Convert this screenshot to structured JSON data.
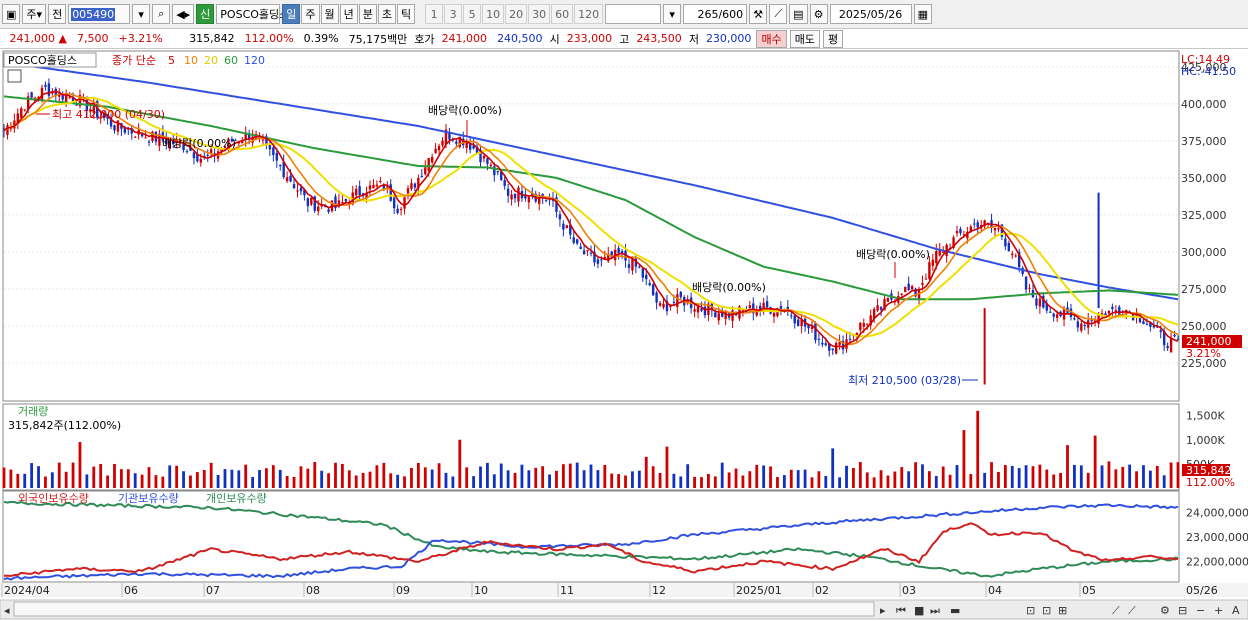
{
  "toolbar": {
    "type_label": "주",
    "prev_label": "전",
    "code": "005490",
    "badge": "신",
    "name": "POSCO홀딩스",
    "periods": [
      "일",
      "주",
      "월",
      "년",
      "분",
      "초",
      "틱"
    ],
    "active_period": "일",
    "intervals": [
      "1",
      "3",
      "5",
      "10",
      "20",
      "30",
      "60",
      "120"
    ],
    "count": "265",
    "count_max": "/600",
    "date": "2025/05/26"
  },
  "infobar": {
    "price": "241,000",
    "arrow": "▲",
    "change": "7,500",
    "change_pct": "+3.21%",
    "volume": "315,842",
    "vol_ratio": "112.00%",
    "turnover": "0.39%",
    "amount": "75,175백만",
    "quote_label": "호가",
    "ask": "241,000",
    "bid": "240,500",
    "open_label": "시",
    "open": "233,000",
    "high_label": "고",
    "high": "243,500",
    "low_label": "저",
    "low": "230,000",
    "buy_label": "매수",
    "sell_label": "매도",
    "avg_label": "평"
  },
  "legend": {
    "name": "POSCO홀딩스",
    "series": "종가 단순",
    "ma": [
      "5",
      "10",
      "20",
      "60",
      "120"
    ]
  },
  "side": {
    "lc": "LC:14.49",
    "hc": "HC:-41.50",
    "last": "241,000",
    "pct": "3.21%",
    "vol_last": "315,842",
    "vol_pct": "112.00%"
  },
  "volume_panel": {
    "title": "거래량",
    "value": "315,842주(112.00%)"
  },
  "holdings_panel": {
    "series": [
      "외국인보유수량",
      "기관보유수량",
      "개인보유수량"
    ]
  },
  "annotations": {
    "high": "최고 412,000 (04/30)",
    "low": "최저 210,500 (03/28)",
    "dividend": "배당락(0.00%)"
  },
  "colors": {
    "up": "#d00000",
    "down": "#1030c0",
    "ma5": "#d00000",
    "ma10": "#f08000",
    "ma20": "#f0e000",
    "ma60": "#2a9a3a",
    "ma120": "#3050e0",
    "foreign": "#d02020",
    "inst": "#3050e0",
    "indiv": "#2e8b57",
    "volume": "#d00000"
  },
  "chart_data": {
    "type": "candlestick",
    "price_axis": {
      "ticks": [
        225000,
        250000,
        275000,
        300000,
        325000,
        350000,
        375000,
        400000,
        425000
      ],
      "range": [
        200000,
        435000
      ]
    },
    "volume_axis": {
      "ticks": [
        "1,500K",
        "1,000K",
        "500K"
      ],
      "range": [
        0,
        1700
      ]
    },
    "holdings_axis": {
      "ticks": [
        "24,000,000",
        "23,000,000",
        "22,000,000"
      ],
      "range": [
        21200000,
        24800000
      ]
    },
    "x_labels": [
      "2024/04",
      "06",
      "07",
      "08",
      "09",
      "10",
      "11",
      "12",
      "2025/01",
      "02",
      "03",
      "04",
      "05",
      "05/26"
    ],
    "close_keypoints": [
      [
        0,
        382000
      ],
      [
        6,
        400000
      ],
      [
        12,
        410000
      ],
      [
        22,
        402000
      ],
      [
        32,
        385000
      ],
      [
        42,
        378000
      ],
      [
        52,
        372000
      ],
      [
        58,
        362000
      ],
      [
        66,
        375000
      ],
      [
        72,
        380000
      ],
      [
        82,
        352000
      ],
      [
        88,
        333000
      ],
      [
        96,
        330000
      ],
      [
        104,
        342000
      ],
      [
        110,
        345000
      ],
      [
        114,
        330000
      ],
      [
        120,
        350000
      ],
      [
        124,
        368000
      ],
      [
        128,
        380000
      ],
      [
        134,
        375000
      ],
      [
        140,
        360000
      ],
      [
        146,
        340000
      ],
      [
        152,
        340000
      ],
      [
        158,
        335000
      ],
      [
        166,
        302000
      ],
      [
        172,
        292000
      ],
      [
        178,
        298000
      ],
      [
        184,
        288000
      ],
      [
        190,
        262000
      ],
      [
        196,
        268000
      ],
      [
        202,
        262000
      ],
      [
        210,
        258000
      ],
      [
        218,
        262000
      ],
      [
        226,
        262000
      ],
      [
        232,
        250000
      ],
      [
        238,
        238000
      ],
      [
        242,
        236000
      ],
      [
        248,
        250000
      ],
      [
        254,
        262000
      ],
      [
        260,
        275000
      ],
      [
        264,
        272000
      ],
      [
        270,
        298000
      ],
      [
        276,
        310000
      ],
      [
        282,
        320000
      ],
      [
        288,
        315000
      ],
      [
        292,
        300000
      ],
      [
        296,
        275000
      ],
      [
        300,
        265000
      ],
      [
        306,
        258000
      ],
      [
        312,
        252000
      ],
      [
        318,
        258000
      ],
      [
        324,
        262000
      ],
      [
        330,
        255000
      ],
      [
        336,
        240000
      ],
      [
        340,
        238000
      ]
    ],
    "ma60_keypoints": [
      [
        0,
        405000
      ],
      [
        30,
        398000
      ],
      [
        60,
        385000
      ],
      [
        90,
        370000
      ],
      [
        120,
        358000
      ],
      [
        140,
        357000
      ],
      [
        160,
        350000
      ],
      [
        180,
        335000
      ],
      [
        200,
        310000
      ],
      [
        220,
        290000
      ],
      [
        240,
        280000
      ],
      [
        260,
        268000
      ],
      [
        280,
        268000
      ],
      [
        300,
        272000
      ],
      [
        320,
        274000
      ],
      [
        340,
        271000
      ]
    ],
    "ma120_keypoints": [
      [
        0,
        428000
      ],
      [
        40,
        415000
      ],
      [
        80,
        400000
      ],
      [
        120,
        385000
      ],
      [
        160,
        365000
      ],
      [
        200,
        345000
      ],
      [
        240,
        323000
      ],
      [
        270,
        302000
      ],
      [
        300,
        285000
      ],
      [
        320,
        276000
      ],
      [
        340,
        268000
      ]
    ],
    "foreign_keypoints": [
      [
        0,
        21400000
      ],
      [
        20,
        21700000
      ],
      [
        40,
        21600000
      ],
      [
        60,
        22500000
      ],
      [
        80,
        22100000
      ],
      [
        100,
        22400000
      ],
      [
        120,
        22000000
      ],
      [
        140,
        22800000
      ],
      [
        160,
        22500000
      ],
      [
        175,
        22700000
      ],
      [
        185,
        22000000
      ],
      [
        200,
        21600000
      ],
      [
        220,
        22000000
      ],
      [
        240,
        21700000
      ],
      [
        255,
        22500000
      ],
      [
        265,
        22000000
      ],
      [
        272,
        23200000
      ],
      [
        280,
        23600000
      ],
      [
        285,
        23100000
      ],
      [
        300,
        23200000
      ],
      [
        310,
        22400000
      ],
      [
        320,
        22000000
      ],
      [
        330,
        22200000
      ],
      [
        340,
        22100000
      ]
    ],
    "inst_keypoints": [
      [
        0,
        21300000
      ],
      [
        40,
        21500000
      ],
      [
        80,
        21400000
      ],
      [
        100,
        21700000
      ],
      [
        115,
        21800000
      ],
      [
        125,
        22900000
      ],
      [
        150,
        22600000
      ],
      [
        180,
        22700000
      ],
      [
        200,
        23100000
      ],
      [
        240,
        23600000
      ],
      [
        260,
        23800000
      ],
      [
        280,
        24000000
      ],
      [
        300,
        24200000
      ],
      [
        320,
        24300000
      ],
      [
        340,
        24200000
      ]
    ],
    "indiv_keypoints": [
      [
        0,
        24400000
      ],
      [
        30,
        24300000
      ],
      [
        60,
        24200000
      ],
      [
        90,
        23800000
      ],
      [
        110,
        23500000
      ],
      [
        125,
        22600000
      ],
      [
        140,
        22400000
      ],
      [
        160,
        22300000
      ],
      [
        200,
        22100000
      ],
      [
        230,
        22500000
      ],
      [
        250,
        22200000
      ],
      [
        270,
        21700000
      ],
      [
        285,
        21400000
      ],
      [
        300,
        21700000
      ],
      [
        320,
        22000000
      ],
      [
        340,
        22100000
      ]
    ]
  }
}
